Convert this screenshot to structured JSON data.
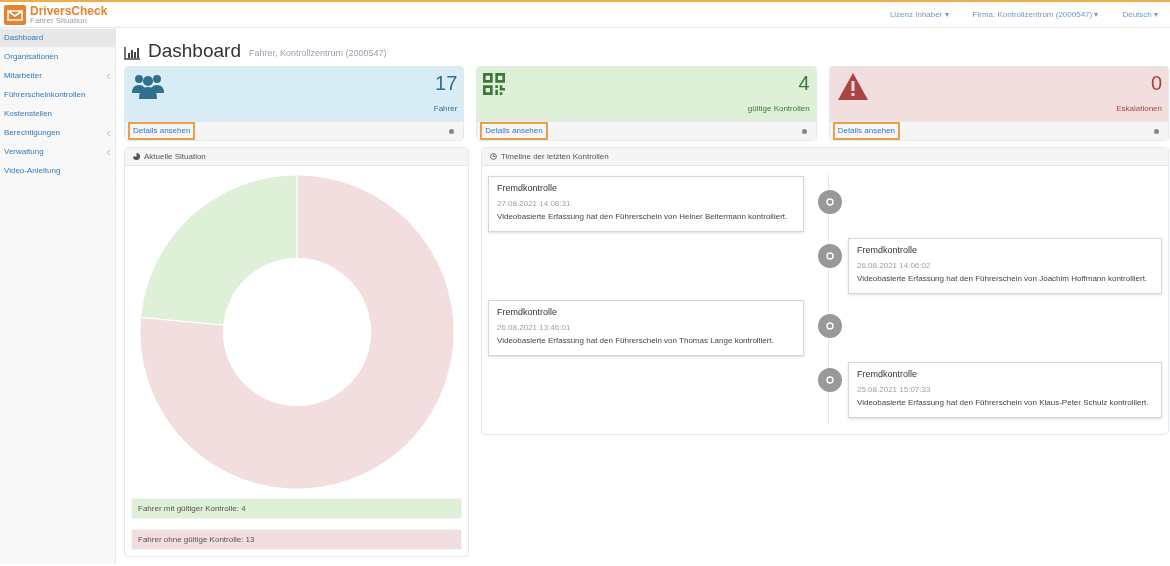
{
  "brand": {
    "name": "DriversCheck",
    "tagline": "Fahrer Situation"
  },
  "topbar": {
    "items": [
      "Lizenz Inhaber ▾",
      "Firma: Kontrollzentrum (2000547) ▾",
      "Deutsch ▾"
    ]
  },
  "sidebar": {
    "items": [
      {
        "label": "Dashboard",
        "selected": true,
        "expandable": false
      },
      {
        "label": "Organisationen",
        "selected": false,
        "expandable": false
      },
      {
        "label": "Mitarbeiter",
        "selected": false,
        "expandable": true
      },
      {
        "label": "Führerscheinkontrollen",
        "selected": false,
        "expandable": false
      },
      {
        "label": "Kostenstellen",
        "selected": false,
        "expandable": false
      },
      {
        "label": "Berechtigungen",
        "selected": false,
        "expandable": true
      },
      {
        "label": "Verwaltung",
        "selected": false,
        "expandable": true
      },
      {
        "label": "Video-Anleitung",
        "selected": false,
        "expandable": false
      }
    ]
  },
  "page": {
    "title": "Dashboard",
    "subtitle": "Fahrer, Kontrollzentrum (2000547)"
  },
  "stats": [
    {
      "kind": "people",
      "value": "17",
      "label": "Fahrer",
      "link": "Details ansehen",
      "color": "#31708f"
    },
    {
      "kind": "qr",
      "value": "4",
      "label": "gültige Kontrollen",
      "link": "Details ansehen",
      "color": "#3c763d"
    },
    {
      "kind": "warning",
      "value": "0",
      "label": "Eskalationen",
      "link": "Details ansehen",
      "color": "#a94442"
    }
  ],
  "situation": {
    "title": "Aktuelle Situation",
    "chart_data": {
      "type": "donut",
      "categories": [
        "Fahrer mit gültiger Kontrolle: 4",
        "Fahrer ohne gültige Kontrolle: 13"
      ],
      "values": [
        4,
        13
      ]
    },
    "legend": [
      {
        "color": "#dff0d8"
      },
      {
        "color": "#f2dede"
      }
    ]
  },
  "timeline": {
    "title": "Timeline der letzten Kontrollen",
    "entries": [
      {
        "title": "Fremdkontrolle",
        "date": "27.08.2021 14:08:31",
        "text": "Videobasierte Erfassung hat den Führerschein von Heiner Beltermann kontrolliert."
      },
      {
        "title": "Fremdkontrolle",
        "date": "26.08.2021 14:06:02",
        "text": "Videobasierte Erfassung hat den Führerschein von Joachim Hoffmann kontrolliert."
      },
      {
        "title": "Fremdkontrolle",
        "date": "26.08.2021 13:46:01",
        "text": "Videobasierte Erfassung hat den Führerschein von Thomas Lange kontrolliert."
      },
      {
        "title": "Fremdkontrolle",
        "date": "25.08.2021 15:07:33",
        "text": "Videobasierte Erfassung hat den Führerschein von Klaus-Peter Schulz kontrolliert."
      }
    ]
  }
}
